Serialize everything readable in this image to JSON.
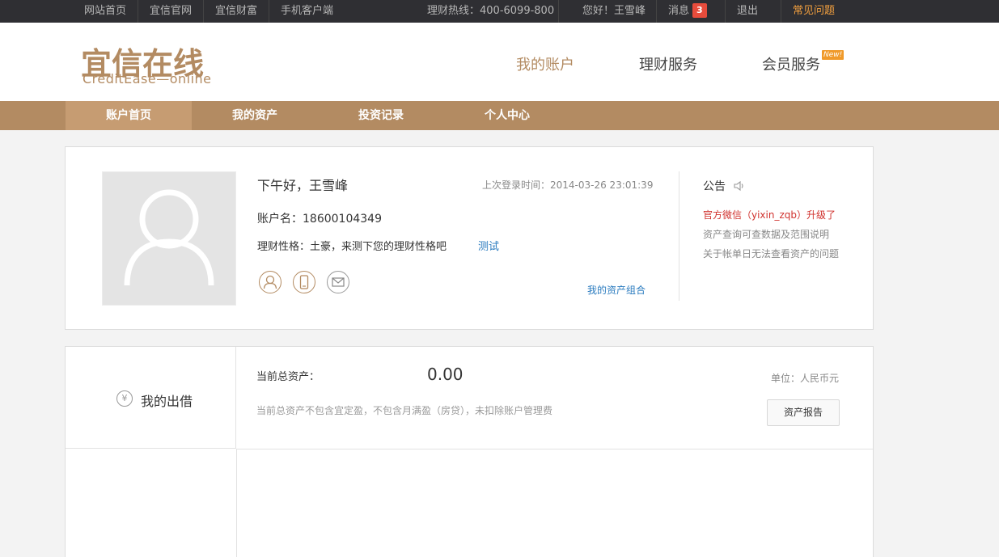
{
  "topbar": {
    "links": [
      "网站首页",
      "宜信官网",
      "宜信财富",
      "手机客户端"
    ],
    "hotline": "理财热线：400-6099-800",
    "greeting": "您好！王雪峰",
    "messages_label": "消息",
    "messages_count": "3",
    "logout": "退出",
    "faq": "常见问题"
  },
  "header": {
    "logo_cn": "宜信在线",
    "logo_en": "CreditEase—online",
    "nav": [
      "我的账户",
      "理财服务",
      "会员服务"
    ],
    "new_tag": "New!"
  },
  "subnav": {
    "tabs": [
      "账户首页",
      "我的资产",
      "投资记录",
      "个人中心"
    ],
    "active": "账户首页"
  },
  "profile": {
    "greeting": "下午好，王雪峰",
    "last_login": "上次登录时间：2014-03-26 23:01:39",
    "account": "账户名：18600104349",
    "risk": "理财性格：土豪，来测下您的理财性格吧",
    "risk_link": "测试",
    "portfolio_link": "我的资产组合",
    "icons": [
      "user-icon",
      "phone-icon",
      "mail-icon"
    ]
  },
  "notice": {
    "title": "公告",
    "items": [
      "官方微信（yixin_zqb）升级了",
      "资产查询可查数据及范围说明",
      "关于帐单日无法查看资产的问题"
    ]
  },
  "assets": {
    "lend_label": "我的出借",
    "yen_symbol": "¥",
    "total_label": "当前总资产：",
    "total_value": "0.00",
    "unit": "单位：人民币元",
    "note": "当前总资产不包含宜定盈，不包含月满盈（房贷），未扣除账户管理费",
    "report_button": "资产报告"
  },
  "colors": {
    "brand": "#b38b62",
    "link": "#2a7bbf",
    "alert": "#d0312d",
    "topbar": "#2f2f33"
  }
}
